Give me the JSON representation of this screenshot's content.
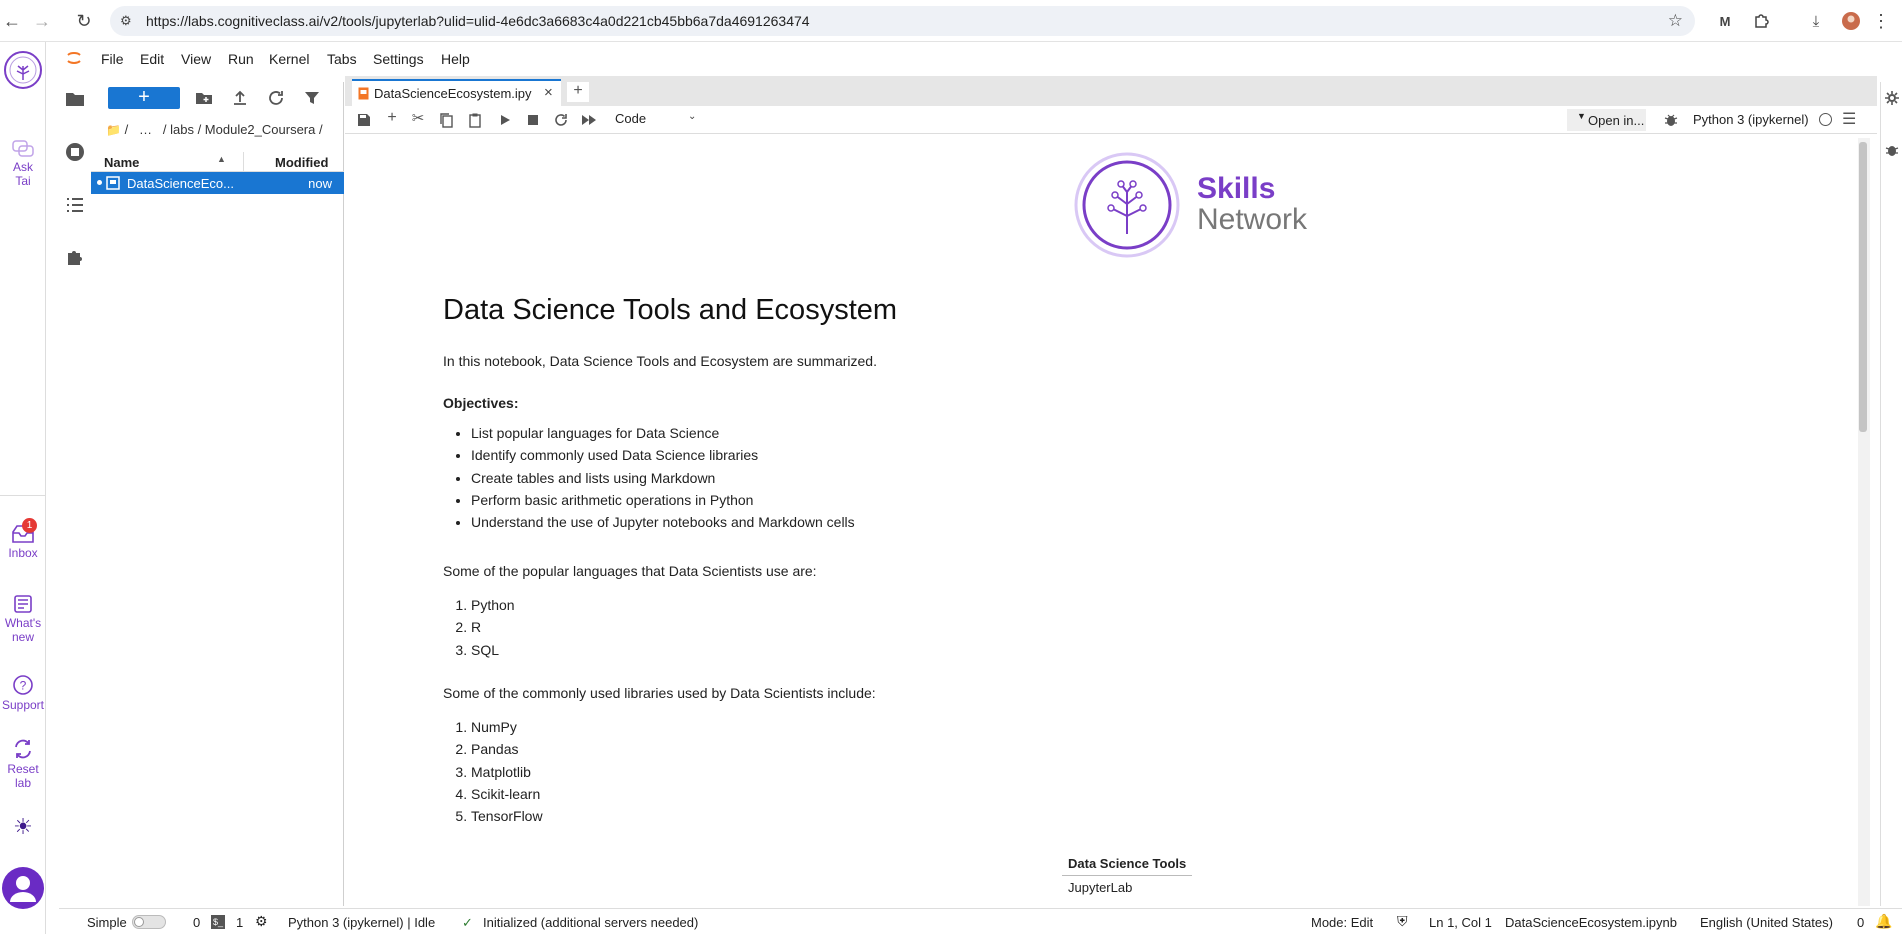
{
  "browser": {
    "url": "https://labs.cognitiveclass.ai/v2/tools/jupyterlab?ulid=ulid-4e6dc3a6683c4a0d221cb45bb6a7da4691263474"
  },
  "ide_rail": {
    "ask_tai_line1": "Ask",
    "ask_tai_line2": "Tai",
    "inbox_label": "Inbox",
    "inbox_badge": "1",
    "whats_new_line1": "What's",
    "whats_new_line2": "new",
    "support_label": "Support",
    "reset_line1": "Reset",
    "reset_line2": "lab"
  },
  "menubar": {
    "items": [
      "File",
      "Edit",
      "View",
      "Run",
      "Kernel",
      "Tabs",
      "Settings",
      "Help"
    ]
  },
  "file_browser": {
    "new_label": "+",
    "breadcrumb_root": "/",
    "breadcrumb_ellipsis": "…",
    "breadcrumb_path": "/ labs / Module2_Coursera /",
    "col_name": "Name",
    "col_modified": "Modified",
    "file_name": "DataScienceEco...",
    "file_modified": "now"
  },
  "tabs": {
    "active_tab_label": "DataScienceEcosystem.ipy"
  },
  "toolbar": {
    "cell_type": "Code",
    "open_in_label": "Open in...",
    "kernel_name": "Python 3 (ipykernel)"
  },
  "notebook": {
    "logo_line1": "Skills",
    "logo_line2": "Network",
    "heading": "Data Science Tools and Ecosystem",
    "intro": "In this notebook, Data Science Tools and Ecosystem are summarized.",
    "objectives_label": "Objectives:",
    "objectives": [
      "List popular languages for Data Science",
      "Identify commonly used Data Science libraries",
      "Create tables and lists using Markdown",
      "Perform basic arithmetic operations in Python",
      "Understand the use of Jupyter notebooks and Markdown cells"
    ],
    "languages_intro": "Some of the popular languages that Data Scientists use are:",
    "languages": [
      "Python",
      "R",
      "SQL"
    ],
    "libraries_intro": "Some of the commonly used libraries used by Data Scientists include:",
    "libraries": [
      "NumPy",
      "Pandas",
      "Matplotlib",
      "Scikit-learn",
      "TensorFlow"
    ],
    "tools_table_header": "Data Science Tools",
    "tools_table_rows": [
      "JupyterLab"
    ]
  },
  "status_bar": {
    "simple_label": "Simple",
    "terminals_count": "0",
    "kernels_count": "1",
    "kernel_status": "Python 3 (ipykernel) | Idle",
    "server_status": "Initialized (additional servers needed)",
    "mode": "Mode: Edit",
    "cursor": "Ln 1, Col 1",
    "filename": "DataScienceEcosystem.ipynb",
    "language": "English (United States)",
    "notifications": "0"
  },
  "colors": {
    "brand_purple": "#7a3ec7",
    "jupyter_blue": "#1976d2",
    "jupyter_orange": "#f37626"
  }
}
